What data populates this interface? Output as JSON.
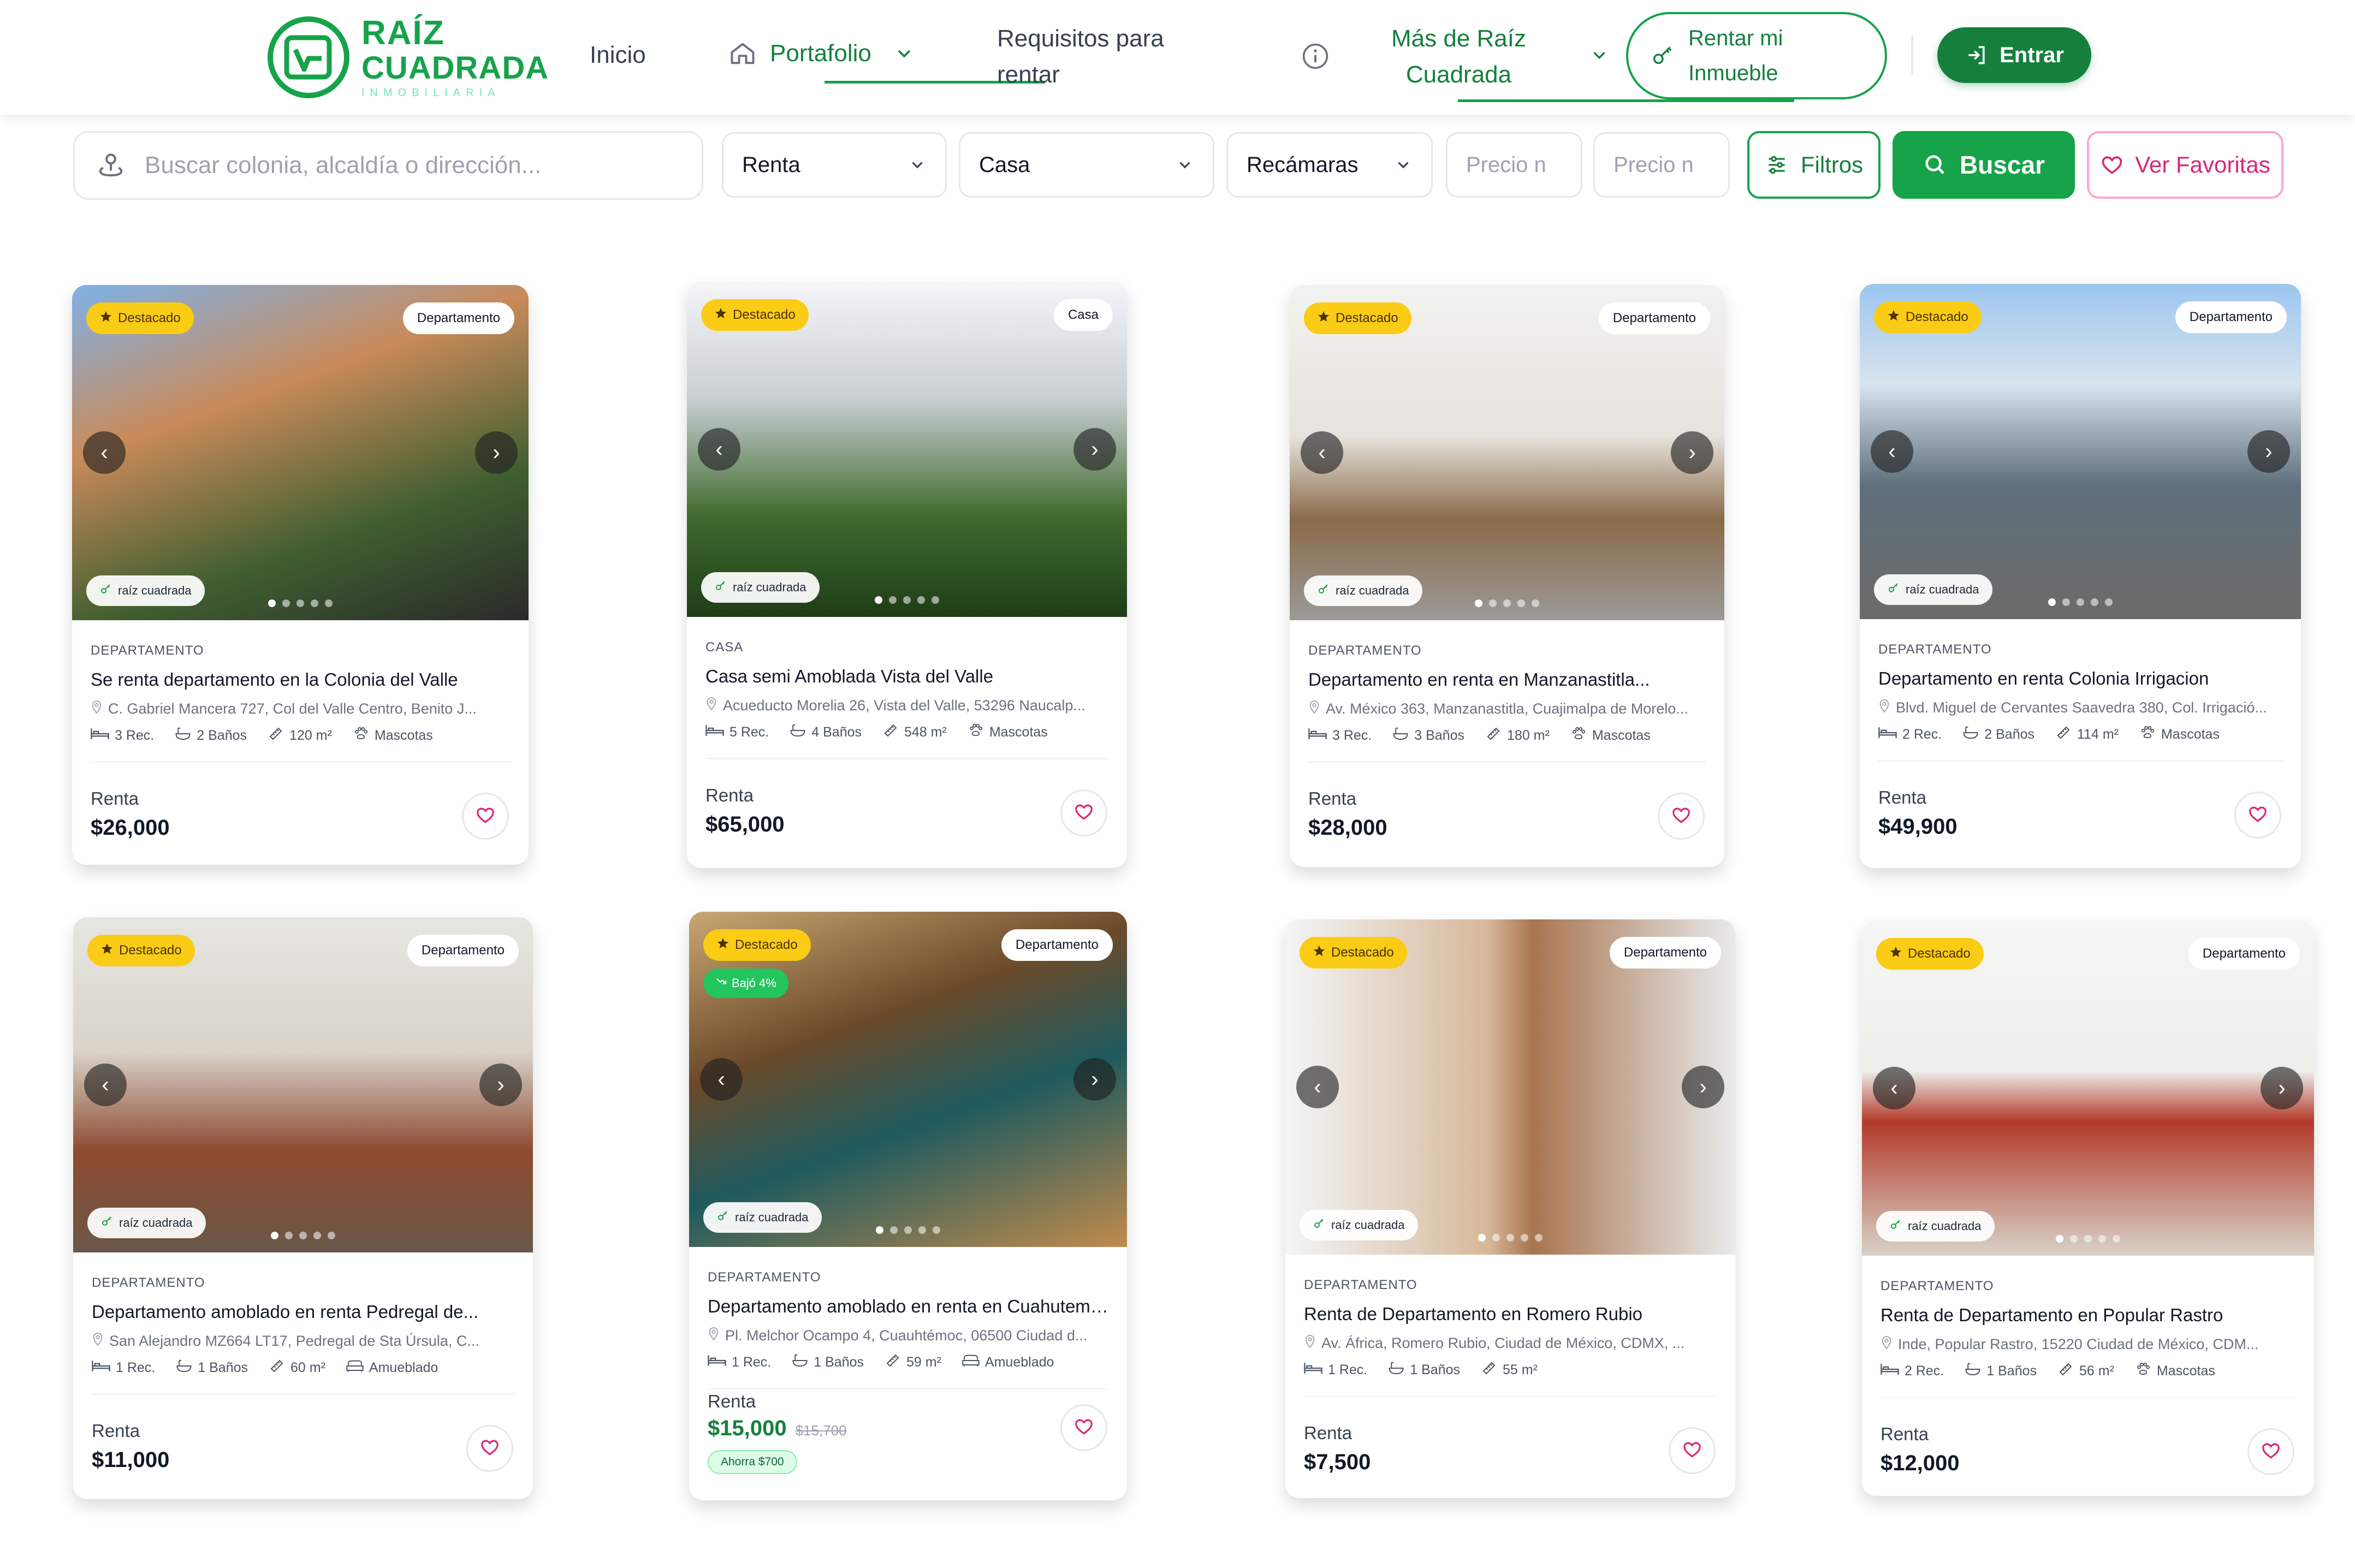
{
  "brand": {
    "line1": "RAÍZ",
    "line2": "CUADRADA",
    "line3": "INMOBILIARIA"
  },
  "nav": {
    "inicio": "Inicio",
    "portafolio": "Portafolio",
    "requisitos_1": "Requisitos para",
    "requisitos_2": "rentar",
    "mas_1": "Más de Raíz",
    "mas_2": "Cuadrada",
    "rentar_1": "Rentar mi",
    "rentar_2": "Inmueble",
    "entrar": "Entrar"
  },
  "filters": {
    "search_placeholder": "Buscar colonia, alcaldía o dirección...",
    "operation": "Renta",
    "property_type": "Casa",
    "bedrooms": "Recámaras",
    "price_min": "Precio n",
    "price_max": "Precio n",
    "filters_label": "Filtros",
    "search_label": "Buscar",
    "favorites_label": "Ver Favoritas"
  },
  "colors": {
    "brand_green": "#16a34a",
    "featured": "#facc15",
    "favorite": "#db2777"
  },
  "icons": [
    "location-pin-icon",
    "chevron-down-icon",
    "info-icon",
    "home-icon",
    "key-icon",
    "login-icon",
    "sliders-icon",
    "search-icon",
    "heart-icon",
    "star-icon",
    "bed-icon",
    "bath-icon",
    "ruler-icon",
    "paw-icon",
    "sofa-icon"
  ],
  "listings": [
    {
      "featured": "Destacado",
      "type": "Departamento",
      "category": "DEPARTAMENTO",
      "title": "Se renta departamento en la Colonia del Valle",
      "address": "C. Gabriel Mancera 727, Col del Valle Centro, Benito J...",
      "rooms": "3 Rec.",
      "baths": "2 Baños",
      "area": "120 m²",
      "extra": "Mascotas",
      "op": "Renta",
      "price": "$26,000",
      "watermark": "raíz cuadrada"
    },
    {
      "featured": "Destacado",
      "type": "Casa",
      "category": "CASA",
      "title": "Casa semi Amoblada Vista del Valle",
      "address": "Acueducto Morelia 26, Vista del Valle, 53296 Naucalp...",
      "rooms": "5 Rec.",
      "baths": "4 Baños",
      "area": "548 m²",
      "extra": "Mascotas",
      "op": "Renta",
      "price": "$65,000",
      "watermark": "raíz cuadrada"
    },
    {
      "featured": "Destacado",
      "type": "Departamento",
      "category": "DEPARTAMENTO",
      "title": "Departamento en renta en Manzanastitla...",
      "address": "Av. México 363, Manzanastitla, Cuajimalpa de Morelo...",
      "rooms": "3 Rec.",
      "baths": "3 Baños",
      "area": "180 m²",
      "extra": "Mascotas",
      "op": "Renta",
      "price": "$28,000",
      "watermark": "raíz cuadrada"
    },
    {
      "featured": "Destacado",
      "type": "Departamento",
      "category": "DEPARTAMENTO",
      "title": "Departamento en renta Colonia Irrigacion",
      "address": "Blvd. Miguel de Cervantes Saavedra 380, Col. Irrigació...",
      "rooms": "2 Rec.",
      "baths": "2 Baños",
      "area": "114 m²",
      "extra": "Mascotas",
      "op": "Renta",
      "price": "$49,900",
      "watermark": "raíz cuadrada"
    },
    {
      "featured": "Destacado",
      "type": "Departamento",
      "category": "DEPARTAMENTO",
      "title": "Departamento amoblado en renta Pedregal de...",
      "address": "San Alejandro MZ664 LT17, Pedregal de Sta Úrsula, C...",
      "rooms": "1 Rec.",
      "baths": "1 Baños",
      "area": "60 m²",
      "extra": "Amueblado",
      "op": "Renta",
      "price": "$11,000",
      "watermark": "raíz cuadrada"
    },
    {
      "featured": "Destacado",
      "type": "Departamento",
      "drop": "Bajó 4%",
      "category": "DEPARTAMENTO",
      "title": "Departamento amoblado en renta en Cuahutemoc",
      "address": "Pl. Melchor Ocampo 4, Cuauhtémoc, 06500 Ciudad d...",
      "rooms": "1 Rec.",
      "baths": "1 Baños",
      "area": "59 m²",
      "extra": "Amueblado",
      "op": "Renta",
      "price": "$15,000",
      "old_price": "$15,700",
      "savings": "Ahorra $700",
      "watermark": "raíz cuadrada"
    },
    {
      "featured": "Destacado",
      "type": "Departamento",
      "category": "DEPARTAMENTO",
      "title": "Renta de Departamento en Romero Rubio",
      "address": "Av. África, Romero Rubio, Ciudad de México, CDMX, ...",
      "rooms": "1 Rec.",
      "baths": "1 Baños",
      "area": "55 m²",
      "extra": "",
      "op": "Renta",
      "price": "$7,500",
      "watermark": "raíz cuadrada"
    },
    {
      "featured": "Destacado",
      "type": "Departamento",
      "category": "DEPARTAMENTO",
      "title": "Renta de Departamento en Popular Rastro",
      "address": "Inde, Popular Rastro, 15220 Ciudad de México, CDM...",
      "rooms": "2 Rec.",
      "baths": "1 Baños",
      "area": "56 m²",
      "extra": "Mascotas",
      "op": "Renta",
      "price": "$12,000",
      "watermark": "raíz cuadrada"
    }
  ]
}
